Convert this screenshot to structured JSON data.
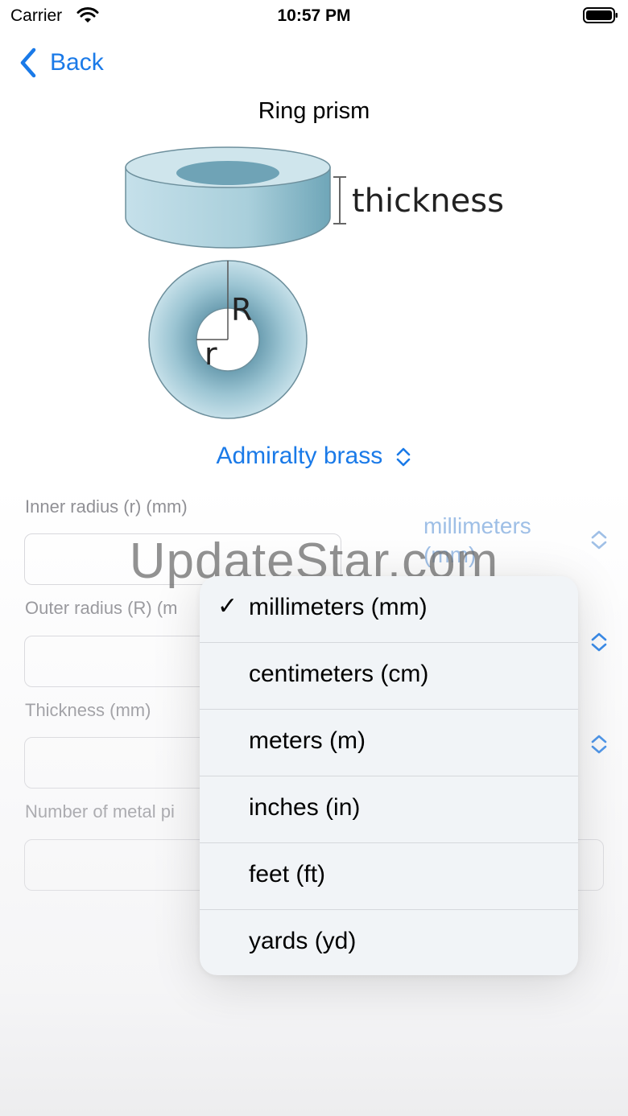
{
  "status_bar": {
    "carrier": "Carrier",
    "time": "10:57 PM"
  },
  "nav": {
    "back_label": "Back"
  },
  "header": {
    "title": "Ring prism"
  },
  "figure": {
    "thickness_label": "thickness",
    "outer_label": "R",
    "inner_label": "r"
  },
  "material": {
    "selected": "Admiralty brass"
  },
  "form": {
    "inner_radius_label": "Inner radius  (r) (mm)",
    "outer_radius_label": "Outer radius (R) (m",
    "thickness_label": "Thickness (mm)",
    "pieces_label": "Number of metal pi",
    "unit_selected": "millimeters (mm)"
  },
  "watermark": "UpdateStar.com",
  "unit_menu": {
    "items": [
      {
        "label": "millimeters (mm)",
        "checked": true
      },
      {
        "label": "centimeters (cm)",
        "checked": false
      },
      {
        "label": "meters (m)",
        "checked": false
      },
      {
        "label": "inches (in)",
        "checked": false
      },
      {
        "label": "feet (ft)",
        "checked": false
      },
      {
        "label": "yards (yd)",
        "checked": false
      }
    ],
    "check_glyph": "✓"
  },
  "colors": {
    "accent": "#1a7ae8",
    "ring_fill": "#b9d7e2",
    "ring_dark": "#6ea3b6"
  }
}
